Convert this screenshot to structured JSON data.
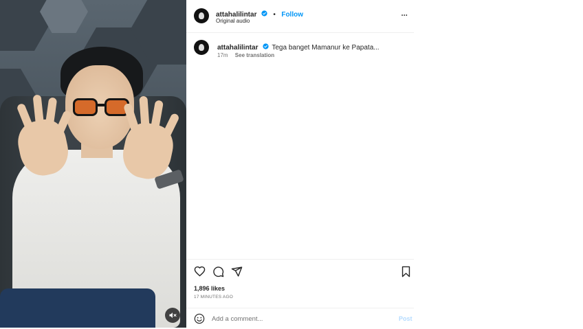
{
  "post": {
    "username": "attahalilintar",
    "follow_label": "Follow",
    "dot": "•",
    "audio_label": "Original audio",
    "more_label": "•••",
    "caption": {
      "username": "attahalilintar",
      "text": "Tega banget Mamanur ke Papata...",
      "time": "17m",
      "see_translation": "See translation"
    },
    "likes": "1,896 likes",
    "time_ago": "17 MINUTES AGO",
    "comment_placeholder": "Add a comment...",
    "post_label": "Post"
  },
  "colors": {
    "accent": "#0095f6",
    "verified": "#0095f6",
    "post_disabled": "#b3dbff"
  },
  "icons": [
    "verified-badge-icon",
    "heart-icon",
    "comment-icon",
    "share-icon",
    "bookmark-icon",
    "emoji-icon",
    "mute-icon"
  ]
}
